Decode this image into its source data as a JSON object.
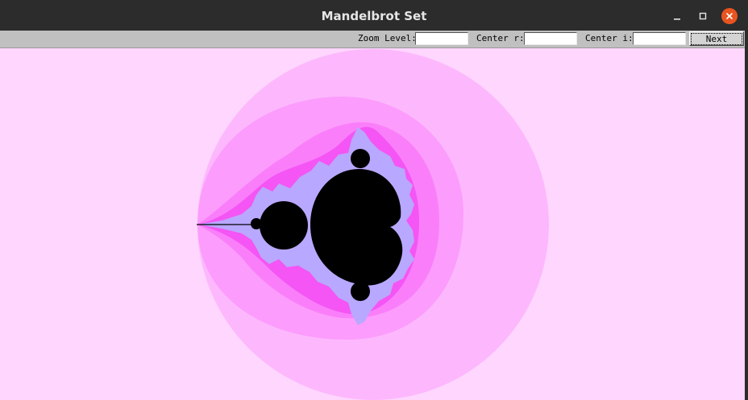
{
  "window": {
    "title": "Mandelbrot Set"
  },
  "toolbar": {
    "zoom_label": "Zoom Level:",
    "zoom_value": "",
    "center_r_label": "Center r:",
    "center_r_value": "",
    "center_i_label": "Center i:",
    "center_i_value": "",
    "next_label": "Next"
  },
  "colors": {
    "background": "#fed6fe",
    "band_1": "#fdb8fd",
    "band_2": "#fc9cfc",
    "band_3": "#fa7efa",
    "band_4": "#f455f4",
    "edge": "#b9a8ff",
    "set": "#000000",
    "titlebar": "#2c2c2c",
    "close_button": "#e95420"
  }
}
